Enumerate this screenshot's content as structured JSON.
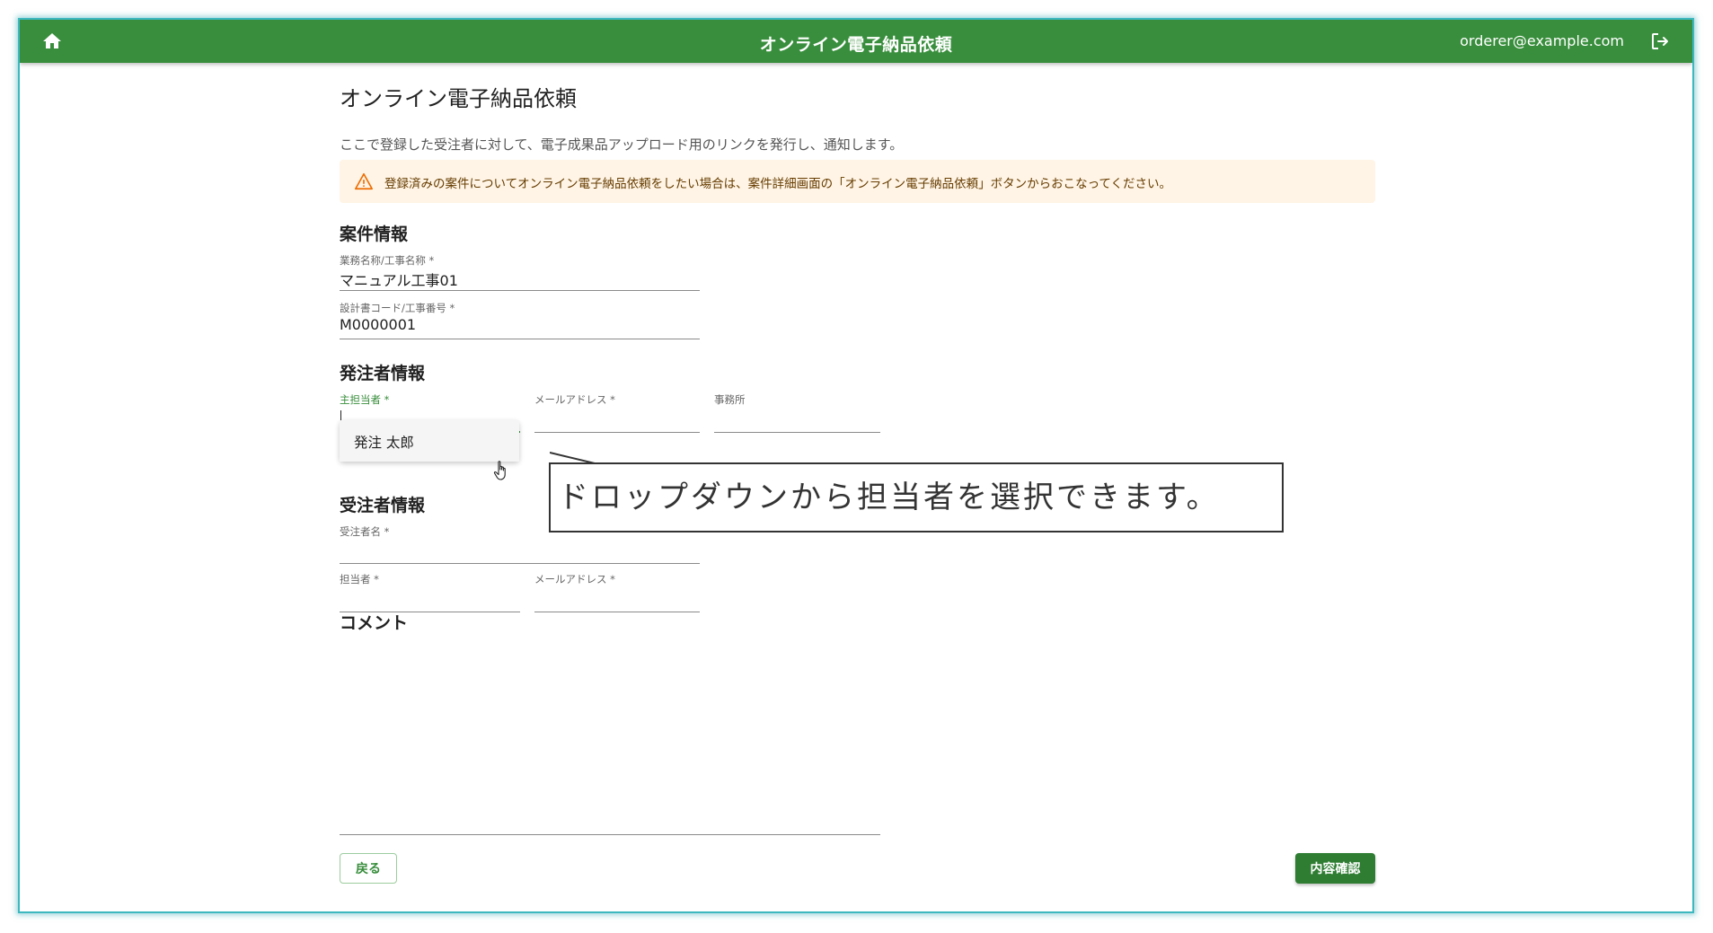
{
  "appbar": {
    "title": "オンライン電子納品依頼",
    "user_email": "orderer@example.com"
  },
  "page": {
    "title": "オンライン電子納品依頼",
    "description": "ここで登録した受注者に対して、電子成果品アップロード用のリンクを発行し、通知します。",
    "alert": "登録済みの案件についてオンライン電子納品依頼をしたい場合は、案件詳細画面の「オンライン電子納品依頼」ボタンからおこなってください。"
  },
  "project": {
    "section_title": "案件情報",
    "name_label": "業務名称/工事名称 *",
    "name_value": "マニュアル工事01",
    "code_label": "設計書コード/工事番号 *",
    "code_value": "M0000001"
  },
  "orderer": {
    "section_title": "発注者情報",
    "main_contact_label": "主担当者 *",
    "main_contact_value": "",
    "email_label": "メールアドレス *",
    "email_value": "",
    "office_label": "事務所",
    "office_value": "",
    "dropdown_options": [
      "発注 太郎"
    ]
  },
  "contractor": {
    "section_title": "受注者情報",
    "name_label": "受注者名 *",
    "name_value": "",
    "contact_label": "担当者 *",
    "contact_value": "",
    "email_label": "メールアドレス *",
    "email_value": ""
  },
  "comment": {
    "section_title": "コメント",
    "value": ""
  },
  "actions": {
    "back_label": "戻る",
    "confirm_label": "内容確認"
  },
  "annotation": {
    "callout_text": "ドロップダウンから担当者を選択できます。"
  },
  "colors": {
    "primary": "#388e3c",
    "alert_bg": "#fff4e5",
    "warning_icon": "#ed6c02",
    "frame_border": "#3db8bf"
  },
  "icons": {
    "home": "home-icon",
    "logout": "logout-icon",
    "warning": "warning-icon",
    "cursor": "hand-pointer-icon"
  }
}
